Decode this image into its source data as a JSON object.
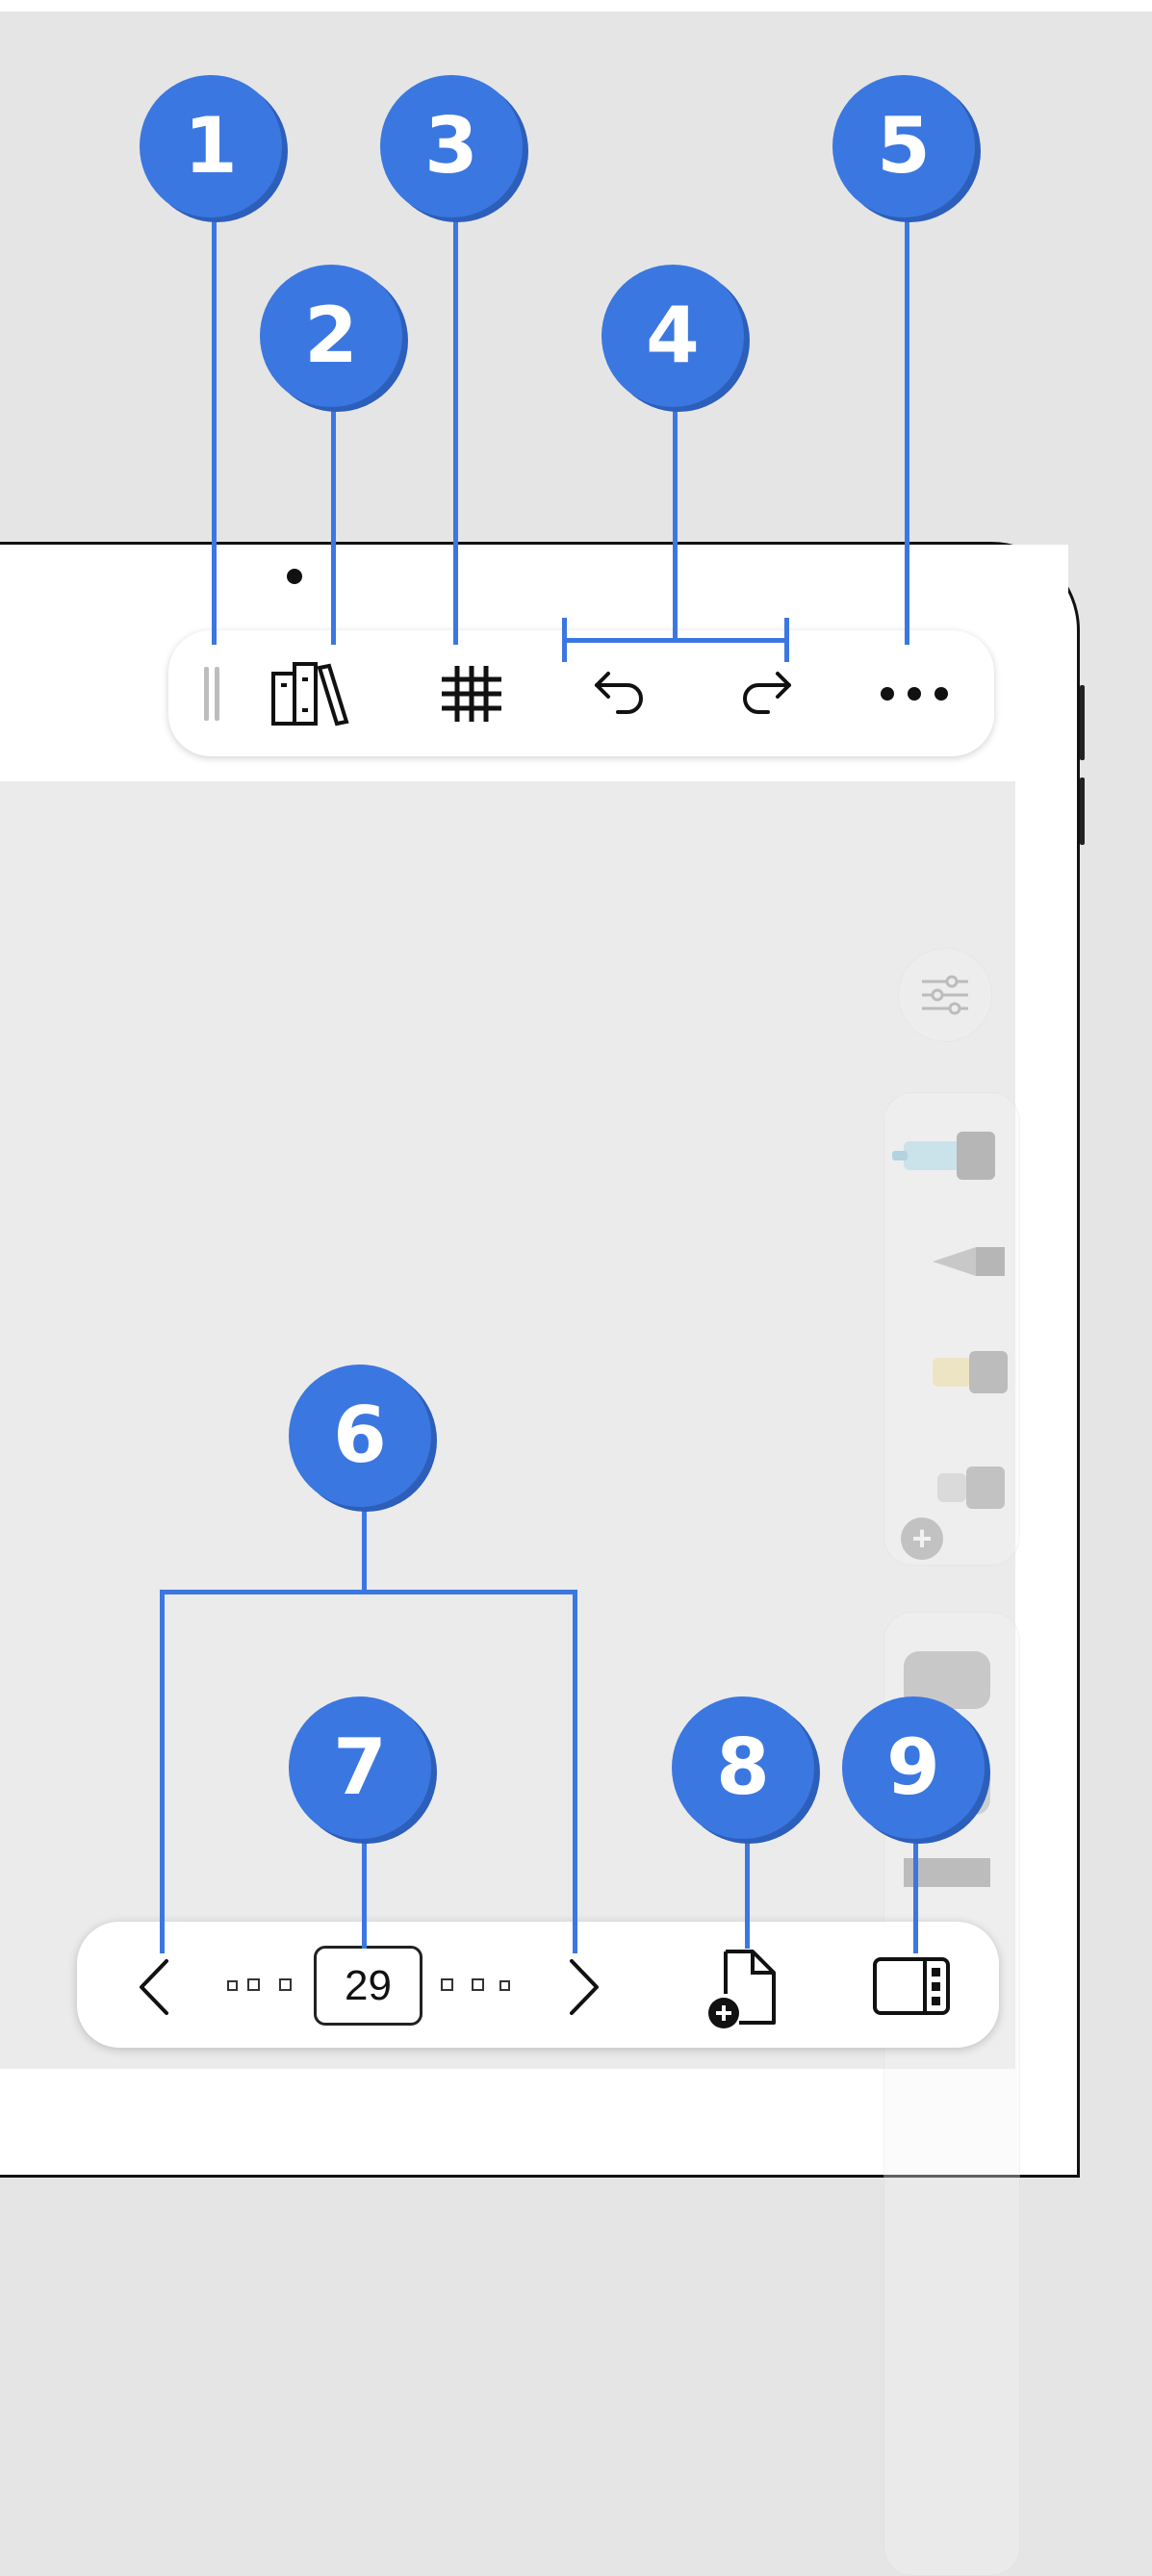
{
  "toolbar": {
    "grip_icon": "drag-handle-icon",
    "library_icon": "library-books-icon",
    "grid_icon": "grid-icon",
    "undo_icon": "undo-icon",
    "redo_icon": "redo-icon",
    "more_icon": "more-options-icon"
  },
  "palette": {
    "settings_icon": "sliders-icon",
    "tools": [
      "marker-icon",
      "fountain-pen-icon",
      "highlighter-icon",
      "add-tool-icon",
      "eraser-icon"
    ]
  },
  "bottom_bar": {
    "prev_icon": "chevron-left-icon",
    "next_icon": "chevron-right-icon",
    "page_number": "29",
    "add_page_icon": "add-page-icon",
    "sidebar_icon": "sidebar-panel-icon"
  },
  "callouts": [
    "1",
    "2",
    "3",
    "4",
    "5",
    "6",
    "7",
    "8",
    "9"
  ],
  "colors": {
    "accent": "#3b77e0",
    "accent_shadow": "#2c5fba"
  }
}
